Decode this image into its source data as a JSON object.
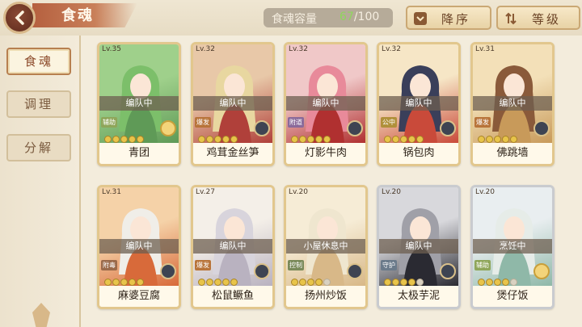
{
  "header": {
    "title": "食魂",
    "capacity_label": "食魂容量",
    "capacity_current": "67",
    "capacity_total": "/100",
    "sort_order_label": "降序",
    "sort_by_label": "等级"
  },
  "sidebar": {
    "items": [
      {
        "label": "食魂",
        "active": true
      },
      {
        "label": "调理",
        "active": false
      },
      {
        "label": "分解",
        "active": false
      }
    ]
  },
  "cards": [
    {
      "level": "Lv.35",
      "status": "编队中",
      "role": "辅助",
      "name": "青团",
      "stars": 5,
      "colors": [
        "#9fd08b",
        "#5f9a57"
      ],
      "hair": "#7cbf6a"
    },
    {
      "level": "Lv.32",
      "status": "编队中",
      "role": "爆发",
      "name": "鸡茸金丝笋",
      "stars": 5,
      "colors": [
        "#e8c8a8",
        "#b0403a"
      ],
      "hair": "#e8d7a0"
    },
    {
      "level": "Lv.32",
      "status": "编队中",
      "role": "附道",
      "name": "灯影牛肉",
      "stars": 5,
      "colors": [
        "#f0c8c8",
        "#b03030"
      ],
      "hair": "#e88a9a"
    },
    {
      "level": "Lv.32",
      "status": "编队中",
      "role": "公中",
      "name": "锅包肉",
      "stars": 5,
      "colors": [
        "#f6e6c6",
        "#c94a3a"
      ],
      "hair": "#3a3f5a"
    },
    {
      "level": "Lv.31",
      "status": "编队中",
      "role": "爆发",
      "name": "佛跳墙",
      "stars": 5,
      "colors": [
        "#f3e0b8",
        "#c89a5a"
      ],
      "hair": "#8a5a3a"
    },
    {
      "level": "Lv.31",
      "status": "编队中",
      "role": "附毒",
      "name": "麻婆豆腐",
      "stars": 5,
      "colors": [
        "#f5d2a8",
        "#d86a3a"
      ],
      "hair": "#f0eee8"
    },
    {
      "level": "Lv.27",
      "status": "编队中",
      "role": "爆发",
      "name": "松鼠鳜鱼",
      "stars": 5,
      "colors": [
        "#f4efe8",
        "#b9b2c0"
      ],
      "hair": "#d8d4dc"
    },
    {
      "level": "Lv.20",
      "status": "小屋休息中",
      "role": "控制",
      "name": "扬州炒饭",
      "stars": 4,
      "colors": [
        "#f6ecd6",
        "#d8b888"
      ],
      "hair": "#efe6cf"
    },
    {
      "level": "Lv.20",
      "status": "编队中",
      "role": "守护",
      "name": "太极芋泥",
      "stars": 4,
      "colors": [
        "#d8d8dc",
        "#2a2a32"
      ],
      "hair": "#a0a0a8"
    },
    {
      "level": "Lv.20",
      "status": "烹饪中",
      "role": "辅助",
      "name": "煲仔饭",
      "stars": 4,
      "colors": [
        "#e9eef0",
        "#8fb8a8"
      ],
      "hair": "#e6ece8"
    }
  ]
}
